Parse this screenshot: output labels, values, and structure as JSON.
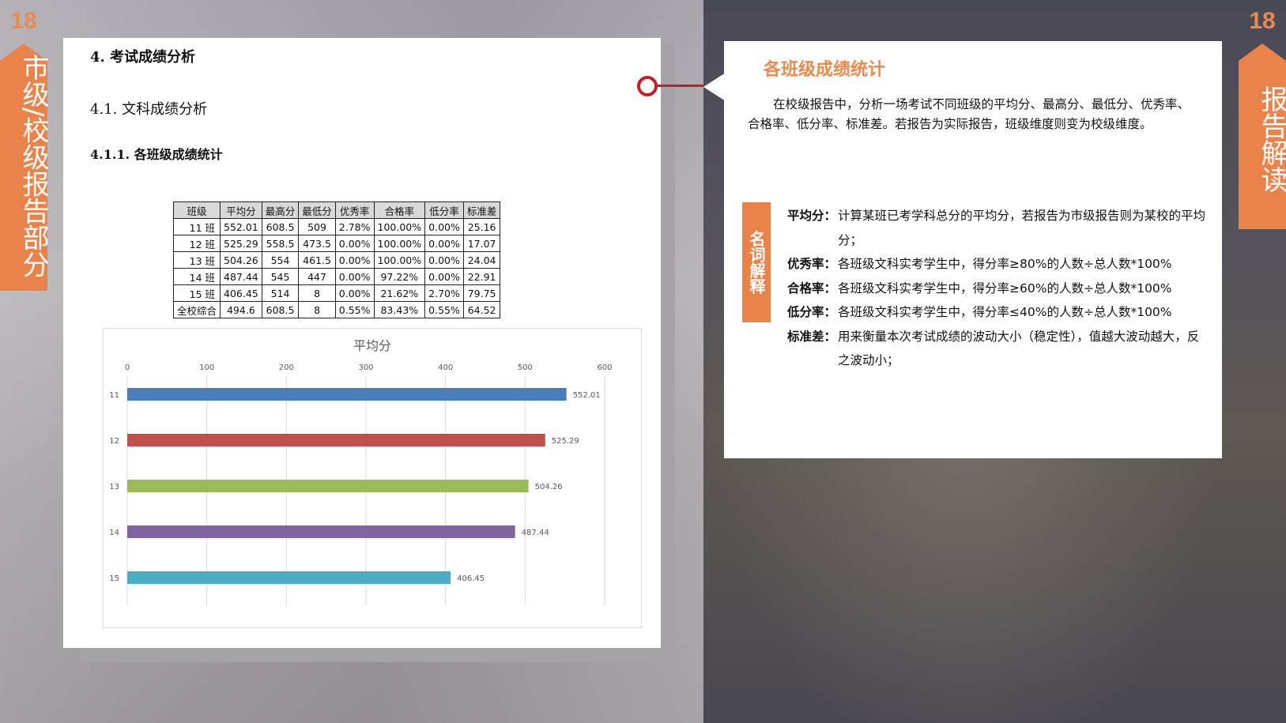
{
  "page_number": "18",
  "left_tab": {
    "number": "18",
    "label": "市级/校级报告部分"
  },
  "right_tab": {
    "number": "18",
    "label": "报告解读"
  },
  "document": {
    "heading1": "4.  考试成绩分析",
    "heading2": "4.1. 文科成绩分析",
    "heading3": "4.1.1. 各班级成绩统计",
    "table": {
      "headers": [
        "班级",
        "平均分",
        "最高分",
        "最低分",
        "优秀率",
        "合格率",
        "低分率",
        "标准差"
      ],
      "rows": [
        [
          "11 班",
          "552.01",
          "608.5",
          "509",
          "2.78%",
          "100.00%",
          "0.00%",
          "25.16"
        ],
        [
          "12 班",
          "525.29",
          "558.5",
          "473.5",
          "0.00%",
          "100.00%",
          "0.00%",
          "17.07"
        ],
        [
          "13 班",
          "504.26",
          "554",
          "461.5",
          "0.00%",
          "100.00%",
          "0.00%",
          "24.04"
        ],
        [
          "14 班",
          "487.44",
          "545",
          "447",
          "0.00%",
          "97.22%",
          "0.00%",
          "22.91"
        ],
        [
          "15 班",
          "406.45",
          "514",
          "8",
          "0.00%",
          "21.62%",
          "2.70%",
          "79.75"
        ],
        [
          "全校综合",
          "494.6",
          "608.5",
          "8",
          "0.55%",
          "83.43%",
          "0.55%",
          "64.52"
        ]
      ]
    }
  },
  "chart_data": {
    "type": "bar",
    "orientation": "horizontal",
    "title": "平均分",
    "categories": [
      "11",
      "12",
      "13",
      "14",
      "15"
    ],
    "values": [
      552.01,
      525.29,
      504.26,
      487.44,
      406.45
    ],
    "value_labels": [
      "552.01",
      "525.29",
      "504.26",
      "487.44",
      "406.45"
    ],
    "colors": [
      "#4a7ebb",
      "#c0504d",
      "#9bbb59",
      "#8064a2",
      "#4bacc6"
    ],
    "xlim": [
      0,
      600
    ],
    "xticks": [
      "0",
      "100",
      "200",
      "300",
      "400",
      "500",
      "600"
    ],
    "x_axis_position": "top",
    "grid": true,
    "xlabel": "",
    "ylabel": ""
  },
  "panel": {
    "title": "各班级成绩统计",
    "intro": "在校级报告中，分析一场考试不同班级的平均分、最高分、最低分、优秀率、合格率、低分率、标准差。若报告为实际报告，班级维度则变为校级维度。",
    "glossary_label": "名词解释",
    "glossary": [
      {
        "term": "平均分",
        "sep": "：",
        "def": "计算某班已考学科总分的平均分，若报告为市级报告则为某校的平均分；"
      },
      {
        "term": "优秀率",
        "sep": "：",
        "def": "各班级文科实考学生中，得分率≥80%的人数÷总人数*100%"
      },
      {
        "term": "合格率",
        "sep": "：",
        "def": "各班级文科实考学生中，得分率≥60%的人数÷总人数*100%"
      },
      {
        "term": "低分率",
        "sep": "：",
        "def": "各班级文科实考学生中，得分率≤40%的人数÷总人数*100%"
      },
      {
        "term": "标准差",
        "sep": "：",
        "def": "用来衡量本次考试成绩的波动大小（稳定性），值越大波动越大，反之波动小；"
      }
    ]
  }
}
